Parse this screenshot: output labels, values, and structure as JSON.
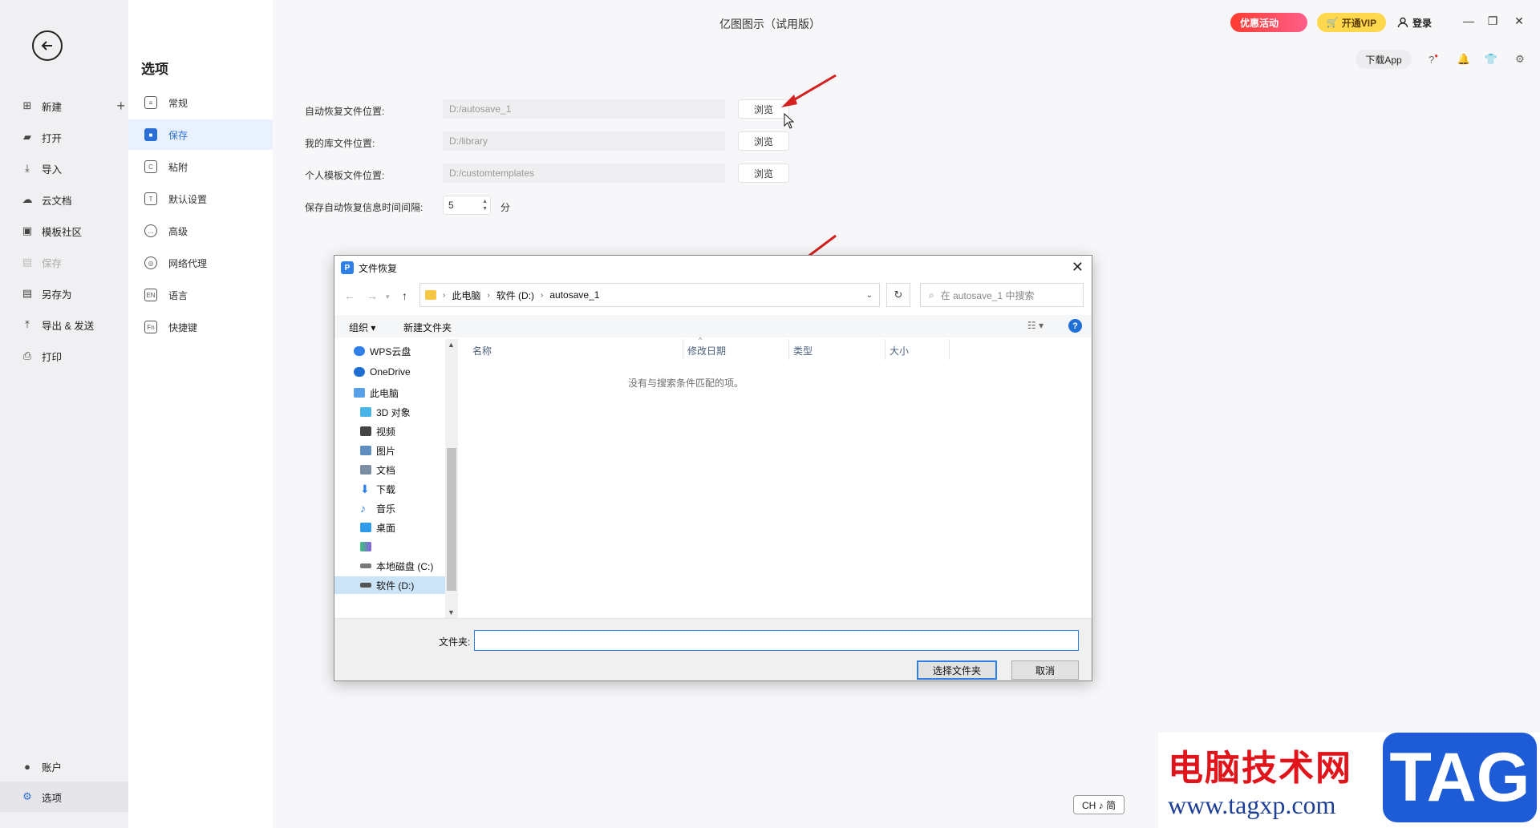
{
  "app": {
    "title": "亿图图示（试用版）"
  },
  "topbar": {
    "promo_label": "优惠活动",
    "vip_label": "开通VIP",
    "login_label": "登录",
    "download_app_label": "下载App"
  },
  "left_nav": {
    "items": [
      {
        "label": "新建"
      },
      {
        "label": "打开"
      },
      {
        "label": "导入"
      },
      {
        "label": "云文档"
      },
      {
        "label": "模板社区"
      },
      {
        "label": "保存"
      },
      {
        "label": "另存为"
      },
      {
        "label": "导出 & 发送"
      },
      {
        "label": "打印"
      }
    ],
    "bottom": [
      {
        "label": "账户"
      },
      {
        "label": "选项"
      }
    ]
  },
  "options": {
    "title": "选项",
    "items": [
      {
        "label": "常规",
        "icon": "≡"
      },
      {
        "label": "保存",
        "icon": "■"
      },
      {
        "label": "粘附",
        "icon": "C"
      },
      {
        "label": "默认设置",
        "icon": "T"
      },
      {
        "label": "高级",
        "icon": "…"
      },
      {
        "label": "网络代理",
        "icon": "◎"
      },
      {
        "label": "语言",
        "icon": "EN"
      },
      {
        "label": "快捷键",
        "icon": "Fn"
      }
    ]
  },
  "settings": {
    "autosave": {
      "label": "自动恢复文件位置:",
      "value": "D:/autosave_1",
      "button": "浏览"
    },
    "library": {
      "label": "我的库文件位置:",
      "value": "D:/library",
      "button": "浏览"
    },
    "templates": {
      "label": "个人模板文件位置:",
      "value": "D:/customtemplates",
      "button": "浏览"
    },
    "interval": {
      "label": "保存自动恢复信息时间间隔:",
      "value": "5",
      "unit": "分"
    }
  },
  "dialog": {
    "title": "文件恢复",
    "breadcrumb": [
      "此电脑",
      "软件 (D:)",
      "autosave_1"
    ],
    "search_placeholder": "在 autosave_1 中搜索",
    "toolbar": {
      "organize": "组织 ▾",
      "new_folder": "新建文件夹"
    },
    "tree": [
      {
        "label": "WPS云盘",
        "color": "#2f7fe8"
      },
      {
        "label": "OneDrive",
        "color": "#1c6fd0"
      },
      {
        "label": "此电脑",
        "color": "#5aa0e8"
      },
      {
        "label": "3D 对象",
        "color": "#46b5e6"
      },
      {
        "label": "视频",
        "color": "#444444"
      },
      {
        "label": "图片",
        "color": "#5f8fbf"
      },
      {
        "label": "文档",
        "color": "#7a8da3"
      },
      {
        "label": "下载",
        "color": "#2f7fe8"
      },
      {
        "label": "音乐",
        "color": "#2f7fe8"
      },
      {
        "label": "桌面",
        "color": "#2f9ae8"
      },
      {
        "label": "",
        "color": "#3bc47a"
      },
      {
        "label": "本地磁盘 (C:)",
        "color": "#777777"
      },
      {
        "label": "软件 (D:)",
        "color": "#555555"
      }
    ],
    "columns": [
      "名称",
      "修改日期",
      "类型",
      "大小"
    ],
    "empty_message": "没有与搜索条件匹配的项。",
    "folder_label": "文件夹:",
    "folder_value": "",
    "select_button": "选择文件夹",
    "cancel_button": "取消"
  },
  "ime": {
    "label": "CH ♪ 简"
  },
  "watermark": {
    "cn": "电脑技术网",
    "url": "www.tagxp.com",
    "tag": "TAG"
  }
}
